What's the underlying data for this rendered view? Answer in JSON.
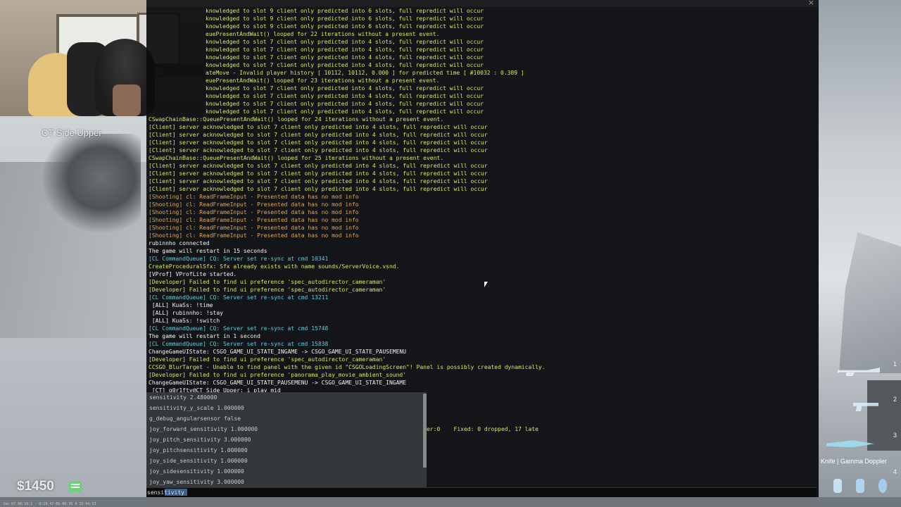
{
  "console": {
    "close_label": "×",
    "log_lines": [
      {
        "text": "knowledged to slot 9 client only predicted into 6 slots, full repredict will occur",
        "color": "y",
        "indent": true
      },
      {
        "text": "knowledged to slot 9 client only predicted into 6 slots, full repredict will occur",
        "color": "y",
        "indent": true
      },
      {
        "text": "knowledged to slot 9 client only predicted into 6 slots, full repredict will occur",
        "color": "y",
        "indent": true
      },
      {
        "text": "euePresentAndWait() looped for 22 iterations without a present event.",
        "color": "y",
        "indent": true
      },
      {
        "text": "knowledged to slot 7 client only predicted into 4 slots, full repredict will occur",
        "color": "y",
        "indent": true
      },
      {
        "text": "knowledged to slot 7 client only predicted into 4 slots, full repredict will occur",
        "color": "y",
        "indent": true
      },
      {
        "text": "knowledged to slot 7 client only predicted into 4 slots, full repredict will occur",
        "color": "y",
        "indent": true
      },
      {
        "text": "knowledged to slot 7 client only predicted into 4 slots, full repredict will occur",
        "color": "y",
        "indent": true
      },
      {
        "text": "ateMove - Invalid player history [ 10112, 10112, 0.000 ] for predicted time [ #10032 : 0.389 ]",
        "color": "y",
        "indent": true
      },
      {
        "text": "euePresentAndWait() looped for 23 iterations without a present event.",
        "color": "y",
        "indent": true
      },
      {
        "text": "knowledged to slot 7 client only predicted into 4 slots, full repredict will occur",
        "color": "y",
        "indent": true
      },
      {
        "text": "knowledged to slot 7 client only predicted into 4 slots, full repredict will occur",
        "color": "y",
        "indent": true
      },
      {
        "text": "knowledged to slot 7 client only predicted into 4 slots, full repredict will occur",
        "color": "y",
        "indent": true
      },
      {
        "text": "knowledged to slot 7 client only predicted into 4 slots, full repredict will occur",
        "color": "y",
        "indent": true
      },
      {
        "text": "CSwapChainBase::QueuePresentAndWait() looped for 24 iterations without a present event.",
        "color": "y",
        "indent": false
      },
      {
        "text": "[Client] server acknowledged to slot 7 client only predicted into 4 slots, full repredict will occur",
        "color": "y",
        "indent": false
      },
      {
        "text": "[Client] server acknowledged to slot 7 client only predicted into 4 slots, full repredict will occur",
        "color": "y",
        "indent": false
      },
      {
        "text": "[Client] server acknowledged to slot 7 client only predicted into 4 slots, full repredict will occur",
        "color": "y",
        "indent": false
      },
      {
        "text": "[Client] server acknowledged to slot 7 client only predicted into 4 slots, full repredict will occur",
        "color": "y",
        "indent": false
      },
      {
        "text": "CSwapChainBase::QueuePresentAndWait() looped for 25 iterations without a present event.",
        "color": "y",
        "indent": false
      },
      {
        "text": "[Client] server acknowledged to slot 7 client only predicted into 4 slots, full repredict will occur",
        "color": "y",
        "indent": false
      },
      {
        "text": "[Client] server acknowledged to slot 7 client only predicted into 4 slots, full repredict will occur",
        "color": "y",
        "indent": false
      },
      {
        "text": "[Client] server acknowledged to slot 7 client only predicted into 4 slots, full repredict will occur",
        "color": "y",
        "indent": false
      },
      {
        "text": "[Client] server acknowledged to slot 7 client only predicted into 4 slots, full repredict will occur",
        "color": "y",
        "indent": false
      },
      {
        "text": "[Shooting] cl: ReadFrameInput - Presented data has no mod info",
        "color": "o",
        "indent": false
      },
      {
        "text": "[Shooting] cl: ReadFrameInput - Presented data has no mod info",
        "color": "o",
        "indent": false
      },
      {
        "text": "[Shooting] cl: ReadFrameInput - Presented data has no mod info",
        "color": "o",
        "indent": false
      },
      {
        "text": "[Shooting] cl: ReadFrameInput - Presented data has no mod info",
        "color": "o",
        "indent": false
      },
      {
        "text": "[Shooting] cl: ReadFrameInput - Presented data has no mod info",
        "color": "o",
        "indent": false
      },
      {
        "text": "[Shooting] cl: ReadFrameInput - Presented data has no mod info",
        "color": "o",
        "indent": false
      },
      {
        "text": "rubinnho connected",
        "color": "w",
        "indent": false
      },
      {
        "text": "The game will restart in 15 seconds",
        "color": "w",
        "indent": false
      },
      {
        "text": "[CL CommandQueue] CQ: Server set re-sync at cmd 10341",
        "color": "c",
        "indent": false
      },
      {
        "text": "CreateProceduralSfx: Sfx already exists with name sounds/ServerVoice.vsnd.",
        "color": "y",
        "indent": false
      },
      {
        "text": "[VProf] VProfLite started.",
        "color": "w",
        "indent": false
      },
      {
        "text": "[Developer] Failed to find ui preference 'spec_autodirector_cameraman'",
        "color": "y",
        "indent": false
      },
      {
        "text": "[Developer] Failed to find ui preference 'spec_autodirector_cameraman'",
        "color": "y",
        "indent": false
      },
      {
        "text": "[CL CommandQueue] CQ: Server set re-sync at cmd 13211",
        "color": "c",
        "indent": false
      },
      {
        "text": " [ALL] KuaSs: !time",
        "color": "w",
        "indent": false
      },
      {
        "text": " [ALL] rubinnho: !stay",
        "color": "w",
        "indent": false
      },
      {
        "text": " [ALL] KuaSs: !switch",
        "color": "w",
        "indent": false
      },
      {
        "text": "[CL CommandQueue] CQ: Server set re-sync at cmd 15748",
        "color": "c",
        "indent": false
      },
      {
        "text": "The game will restart in 1 second",
        "color": "w",
        "indent": false
      },
      {
        "text": "[CL CommandQueue] CQ: Server set re-sync at cmd 15838",
        "color": "c",
        "indent": false
      },
      {
        "text": "ChangeGameUIState: CSGO_GAME_UI_STATE_INGAME -> CSGO_GAME_UI_STATE_PAUSEMENU",
        "color": "w",
        "indent": false
      },
      {
        "text": "[Developer] Failed to find ui preference 'spec_autodirector_cameraman'",
        "color": "y",
        "indent": false
      },
      {
        "text": "CCSGO_BlurTarget - Unable to find panel with the given id \"CSGOLoadingScreen\"! Panel is possibly created dynamically.",
        "color": "y",
        "indent": false
      },
      {
        "text": "[Developer] Failed to find ui preference 'panorama_play_movie_ambient_sound'",
        "color": "y",
        "indent": false
      },
      {
        "text": "ChangeGameUIState: CSGO_GAME_UI_STATE_PAUSEMENU -> CSGO_GAME_UI_STATE_INGAME",
        "color": "w",
        "indent": false
      },
      {
        "text": " [CT] g0r1fty@CT Side Upper: i play mid",
        "color": "w",
        "indent": false
      }
    ],
    "stats_text": "er:0    Fixed: 0 dropped, 17 late",
    "input_value": "sensitivity",
    "autocomplete": [
      "sensitivity 2.480000",
      "sensitivity_y_scale 1.000000",
      "g_debug_angularsensor false",
      "joy_forward_sensitivity 1.000000",
      "joy_pitch_sensitivity 3.000000",
      "joy_pitchsensitivity 1.000000",
      "joy_side_sensitivity 1.000000",
      "joy_sidesensitivity 1.000000",
      "joy_yaw_sensitivity 3.000000"
    ]
  },
  "hud": {
    "location": "CT Side Upper",
    "money": "$1450",
    "timestamp": "Jan 07 08:18:2 - 8:19:47-06-00-35 0 15-04-13",
    "weapon_slots": [
      "1",
      "2",
      "3",
      "4"
    ],
    "knife_name": "Knife | Gamma Doppler",
    "accent_color": "#6fd07a"
  }
}
